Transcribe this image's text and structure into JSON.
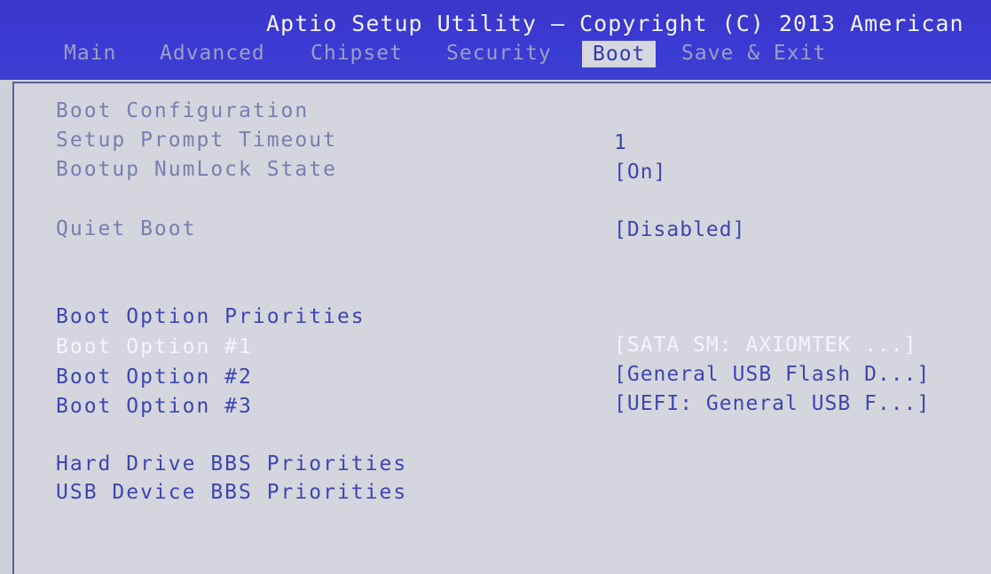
{
  "header": {
    "title": "Aptio Setup Utility – Copyright (C) 2013 American"
  },
  "tabs": [
    {
      "label": "Main"
    },
    {
      "label": "Advanced"
    },
    {
      "label": "Chipset"
    },
    {
      "label": "Security"
    },
    {
      "label": "Boot"
    },
    {
      "label": "Save & Exit"
    }
  ],
  "boot": {
    "section_config": "Boot Configuration",
    "setup_prompt_timeout": {
      "label": "Setup Prompt Timeout",
      "value": "1"
    },
    "numlock_state": {
      "label": "Bootup NumLock State",
      "value": "[On]"
    },
    "quiet_boot": {
      "label": "Quiet Boot",
      "value": "[Disabled]"
    },
    "section_priorities": "Boot Option Priorities",
    "options": [
      {
        "label": "Boot Option #1",
        "value": "[SATA  SM: AXIOMTEK ...]"
      },
      {
        "label": "Boot Option #2",
        "value": "[General USB Flash D...]"
      },
      {
        "label": "Boot Option #3",
        "value": "[UEFI: General USB F...]"
      }
    ],
    "hdd_bbs": "Hard Drive BBS Priorities",
    "usb_bbs": "USB Device BBS Priorities"
  },
  "colors": {
    "header_bg": "#3a3ad4",
    "panel_bg": "#d5d6dd",
    "active_item": "#3c45b5",
    "inactive_item": "#7a7db2",
    "selected_text": "#f4f4fb"
  }
}
